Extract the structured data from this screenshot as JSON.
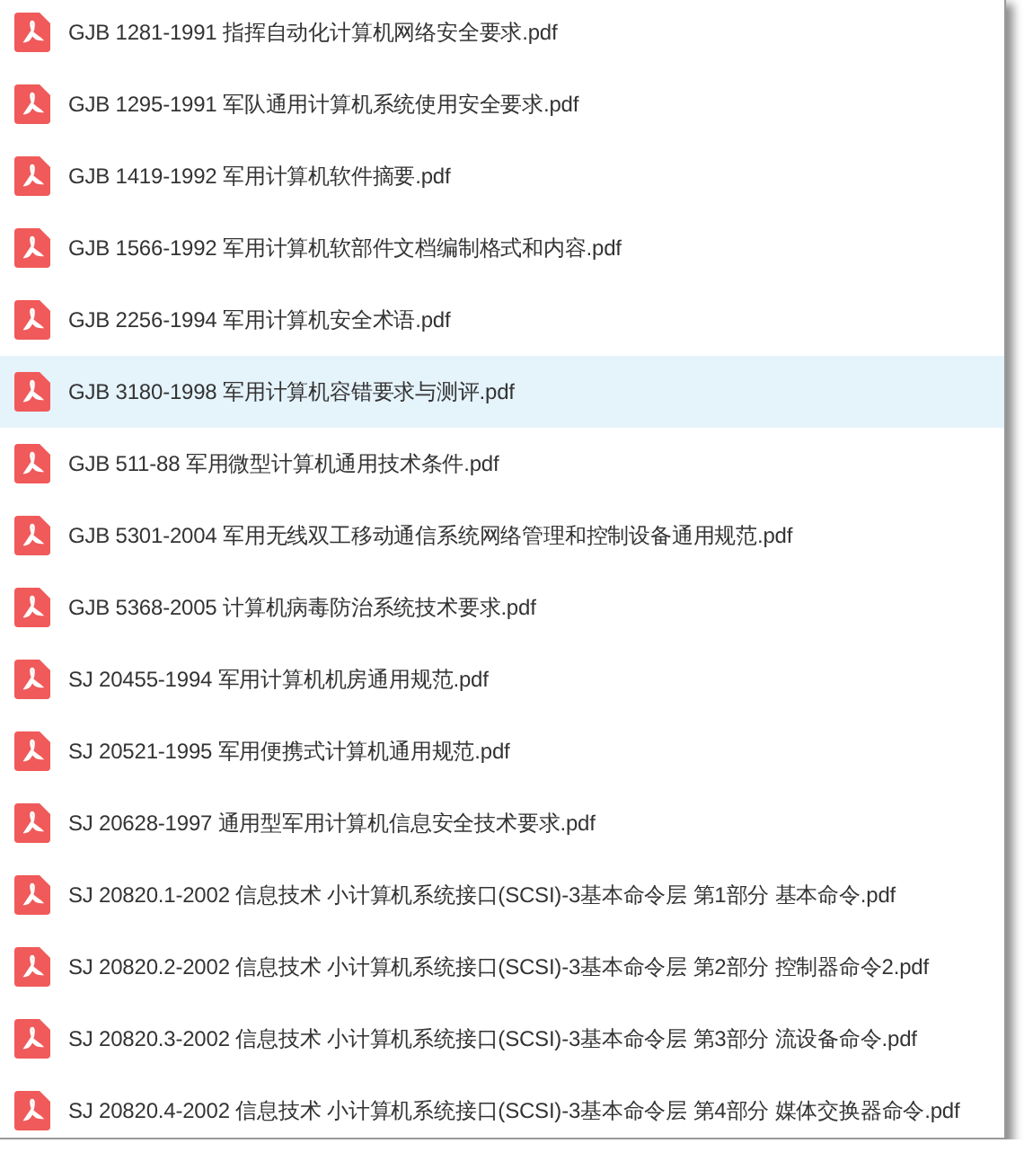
{
  "files": [
    {
      "name": "GJB 1281-1991 指挥自动化计算机网络安全要求.pdf",
      "selected": false
    },
    {
      "name": "GJB 1295-1991 军队通用计算机系统使用安全要求.pdf",
      "selected": false
    },
    {
      "name": "GJB 1419-1992 军用计算机软件摘要.pdf",
      "selected": false
    },
    {
      "name": "GJB 1566-1992 军用计算机软部件文档编制格式和内容.pdf",
      "selected": false
    },
    {
      "name": "GJB 2256-1994 军用计算机安全术语.pdf",
      "selected": false
    },
    {
      "name": "GJB 3180-1998 军用计算机容错要求与测评.pdf",
      "selected": true
    },
    {
      "name": "GJB 511-88 军用微型计算机通用技术条件.pdf",
      "selected": false
    },
    {
      "name": "GJB 5301-2004 军用无线双工移动通信系统网络管理和控制设备通用规范.pdf",
      "selected": false
    },
    {
      "name": "GJB 5368-2005 计算机病毒防治系统技术要求.pdf",
      "selected": false
    },
    {
      "name": "SJ 20455-1994 军用计算机机房通用规范.pdf",
      "selected": false
    },
    {
      "name": "SJ 20521-1995 军用便携式计算机通用规范.pdf",
      "selected": false
    },
    {
      "name": "SJ 20628-1997 通用型军用计算机信息安全技术要求.pdf",
      "selected": false
    },
    {
      "name": "SJ 20820.1-2002 信息技术 小计算机系统接口(SCSI)-3基本命令层 第1部分 基本命令.pdf",
      "selected": false
    },
    {
      "name": "SJ 20820.2-2002 信息技术 小计算机系统接口(SCSI)-3基本命令层 第2部分 控制器命令2.pdf",
      "selected": false
    },
    {
      "name": "SJ 20820.3-2002 信息技术 小计算机系统接口(SCSI)-3基本命令层 第3部分 流设备命令.pdf",
      "selected": false
    },
    {
      "name": "SJ 20820.4-2002 信息技术 小计算机系统接口(SCSI)-3基本命令层 第4部分 媒体交换器命令.pdf",
      "selected": false
    }
  ]
}
